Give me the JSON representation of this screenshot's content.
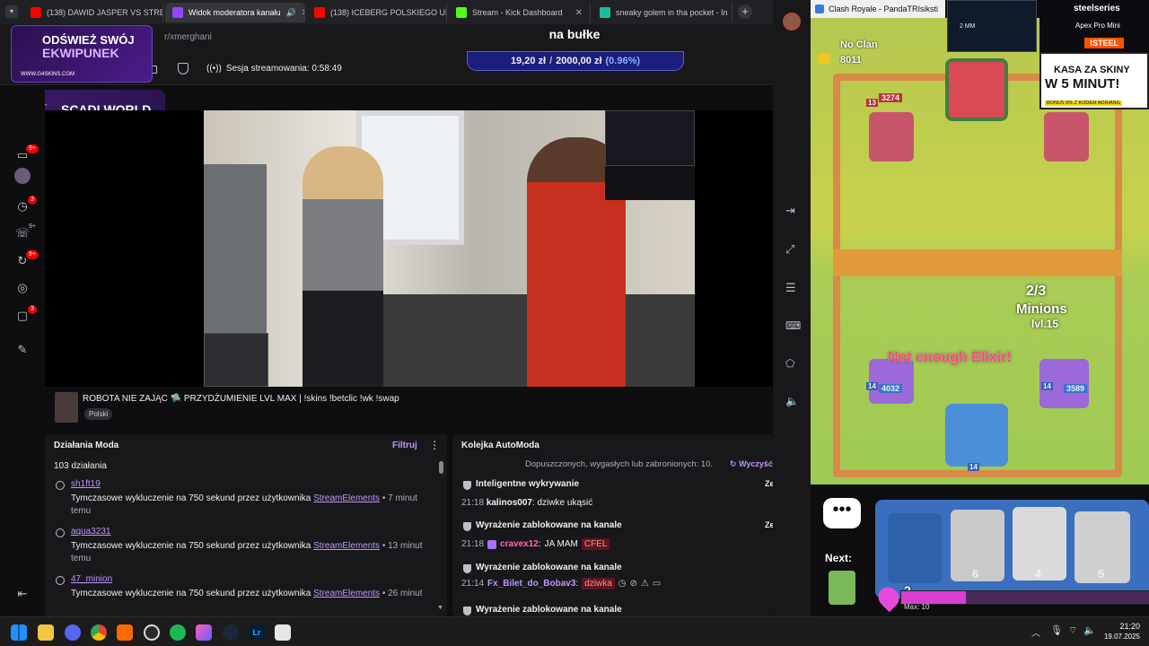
{
  "browser": {
    "tabs": [
      {
        "label": "(138) DAWID JASPER VS STREAM",
        "color": "#ff0000",
        "active": false
      },
      {
        "label": "Widok moderatora kanału",
        "color": "#9146ff",
        "active": true
      },
      {
        "label": "(138) ICEBERG POLSKIEGO UNI",
        "color": "#ff0000",
        "active": false
      },
      {
        "label": "Stream - Kick Dashboard",
        "color": "#53fc18",
        "active": false
      },
      {
        "label": "sneaky golem in tha pocket - In",
        "color": "#1abc9c",
        "active": false
      }
    ],
    "new_tab_glyph": "+",
    "url_fragment": "r/xmerghani"
  },
  "overlay": {
    "ad1_line1": "ODŚWIEŻ SWÓJ",
    "ad1_line2": "EKWIPUNEK",
    "ad1_url": "WWW.G4SKINS.COM",
    "ad2": "SCADI.WORLD",
    "goal_title": "na bułke",
    "goal_current": "19,20 zł",
    "goal_sep": "/",
    "goal_total": "2000,00 zł",
    "goal_pct": "(0.96%)"
  },
  "header": {
    "channel": "merghani",
    "session_label": "Sesja streamowania: 0:58:49"
  },
  "rail_badges": [
    "9+",
    "3",
    "9+",
    "9+",
    "3"
  ],
  "stream": {
    "title": "ROBOTA NIE ZAJĄC 🛸 PRZYDŻUMIENIE LVL MAX | !skins !betclic !wk !swap",
    "tag": "Polski"
  },
  "mod_actions": {
    "title": "Działania Moda",
    "filter": "Filtruj",
    "count": "103 działania",
    "items": [
      {
        "user": "sh1ft19",
        "text": "Tymczasowe wykluczenie na 750 sekund przez użytkownika",
        "by": "StreamElements",
        "time": "• 7 minut",
        "time2": "temu"
      },
      {
        "user": "aqua3231",
        "text": "Tymczasowe wykluczenie na 750 sekund przez użytkownika",
        "by": "StreamElements",
        "time": "• 13 minut",
        "time2": "temu"
      },
      {
        "user": "47_minion",
        "text": "Tymczasowe wykluczenie na 750 sekund przez użytkownika",
        "by": "StreamElements",
        "time": "• 26 minut",
        "time2": "temu"
      }
    ]
  },
  "automod": {
    "title": "Kolejka AutoModa",
    "subtitle": "Dopuszczonych, wygasłych lub zabronionych: 10.",
    "clear": "Wyczyść",
    "items": [
      {
        "label": "Inteligentne wykrywanie",
        "time": "21:18",
        "user": "kalinos007",
        "msg": "dziwke ukąsić",
        "flag": "",
        "user_color": "#efeff1"
      },
      {
        "label": "Wyrażenie zablokowane na kanale",
        "time": "21:18",
        "user": "cravex12",
        "msg": "JA MAM",
        "flag": "CFEL",
        "user_color": "#ff69b4"
      },
      {
        "label": "Wyrażenie zablokowane na kanale",
        "time": "21:14",
        "user": "Fx_Bilet_do_Bobav3",
        "msg": "",
        "flag": "dziwka",
        "user_color": "#bf94ff"
      },
      {
        "label": "Wyrażenie zablokowane na kanale",
        "time": "",
        "user": "",
        "msg": "",
        "flag": "",
        "user_color": "#efeff1"
      }
    ],
    "action_stub": "Ze"
  },
  "game": {
    "window_title": "Clash Royale - PandaTRIsiksti",
    "opponent_clan": "No Clan",
    "opponent_trophies": "8011",
    "tower_hp_top": "3274",
    "tower_lvl": "13",
    "elixir_cost": "2/3",
    "card_name": "Minions",
    "card_lvl": "lvl.15",
    "warning": "Not enough Elixir!",
    "tower_left_lvl": "14",
    "tower_left_hp": "4032",
    "tower_right_lvl": "14",
    "tower_right_hp": "3589",
    "king_lvl": "14",
    "next_label": "Next:",
    "elixir_count": "2",
    "elixir_max": "Max: 10",
    "card_costs": [
      "6",
      "4",
      "5"
    ],
    "sponsor_brand": "steelseries",
    "sponsor_product": "Apex Pro Mini",
    "sponsor_code": "!STEEL",
    "ad_line1": "KASA ZA SKINY",
    "ad_line2": "W 5 MINUT!",
    "ad_line3": "BONUS 5% Z KODEM ADRIANG",
    "cam_label": "2 MM"
  },
  "taskbar": {
    "time": "21:20",
    "date": "19.07.2025"
  }
}
